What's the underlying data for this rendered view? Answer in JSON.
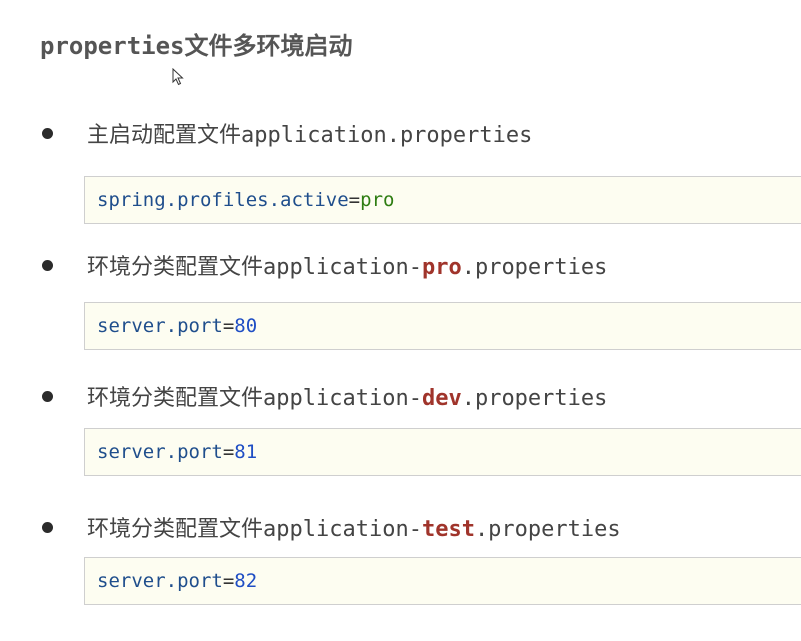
{
  "title": "properties文件多环境启动",
  "items": [
    {
      "prefix": "主启动配置文件application.properties",
      "highlight": "",
      "suffix": "",
      "code_key": "spring.profiles.active",
      "code_op": "=",
      "code_value": "pro"
    },
    {
      "prefix": "环境分类配置文件application-",
      "highlight": "pro",
      "suffix": ".properties",
      "code_key": "server.port",
      "code_op": "=",
      "code_value": "80"
    },
    {
      "prefix": "环境分类配置文件application-",
      "highlight": "dev",
      "suffix": ".properties",
      "code_key": "server.port",
      "code_op": "=",
      "code_value": "81"
    },
    {
      "prefix": "环境分类配置文件application-",
      "highlight": "test",
      "suffix": ".properties",
      "code_key": "server.port",
      "code_op": "=",
      "code_value": "82"
    }
  ],
  "colors": {
    "highlight": "#a0342b",
    "code_key": "#1f4e8c",
    "code_string": "#2e7d12",
    "code_number": "#1f4ec4",
    "code_background": "#fdfdf1"
  },
  "icons": {
    "cursor": "mouse-pointer-icon",
    "bullet": "bullet-dot-icon"
  }
}
